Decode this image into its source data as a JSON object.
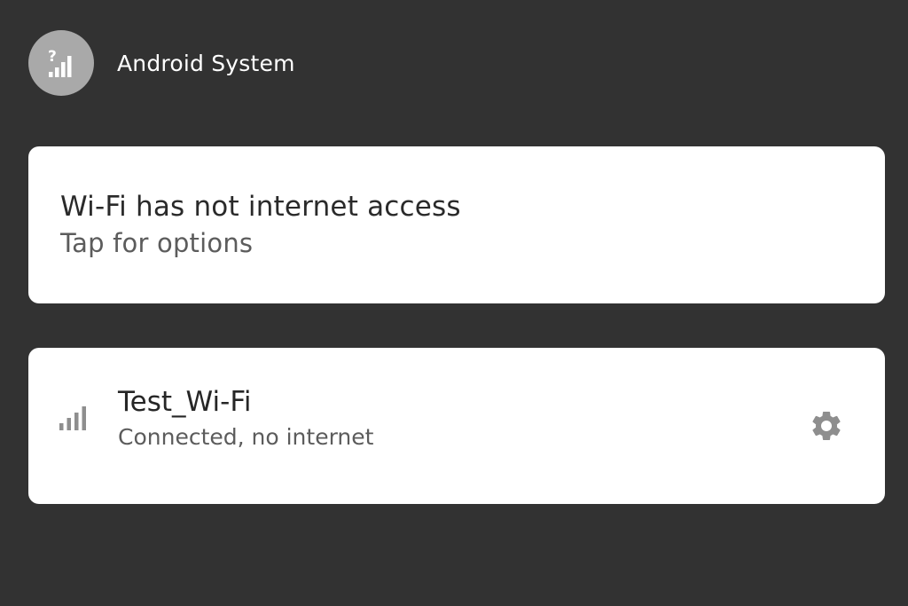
{
  "header": {
    "app_name": "Android System",
    "icon": "signal-question-icon"
  },
  "notification": {
    "title": "Wi-Fi has not internet access",
    "subtitle": "Tap for options"
  },
  "network": {
    "name": "Test_Wi-Fi",
    "status": "Connected, no internet",
    "signal_icon": "signal-strength-icon",
    "settings_icon": "gear-icon"
  },
  "colors": {
    "background": "#323232",
    "card": "#ffffff",
    "icon_circle": "#a9a9a9",
    "muted_icon": "#8e8e8e"
  }
}
